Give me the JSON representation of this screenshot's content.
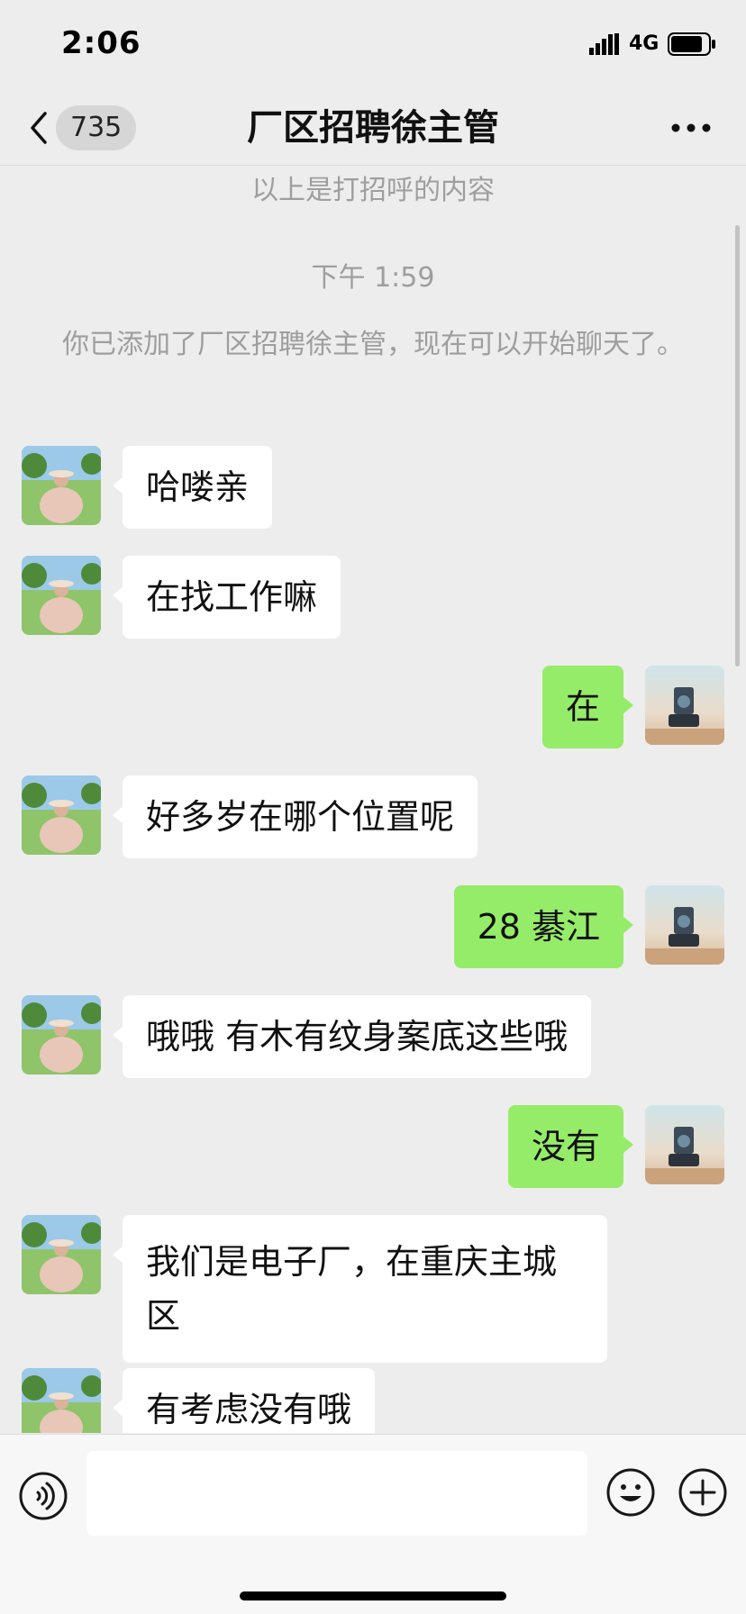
{
  "status_bar": {
    "time": "2:06",
    "network": "4G"
  },
  "nav": {
    "unread_count": "735",
    "title": "厂区招聘徐主管"
  },
  "system": {
    "greeting_note": "以上是打招呼的内容",
    "timestamp": "下午 1:59",
    "added_note": "你已添加了厂区招聘徐主管，现在可以开始聊天了。"
  },
  "messages": [
    {
      "side": "left",
      "text": "哈喽亲"
    },
    {
      "side": "left",
      "text": "在找工作嘛"
    },
    {
      "side": "right",
      "text": "在"
    },
    {
      "side": "left",
      "text": "好多岁在哪个位置呢"
    },
    {
      "side": "right",
      "text": "28 綦江"
    },
    {
      "side": "left",
      "text": "哦哦 有木有纹身案底这些哦"
    },
    {
      "side": "right",
      "text": "没有"
    },
    {
      "side": "left",
      "text": "我们是电子厂，在重庆主城区"
    },
    {
      "side": "left",
      "text": "有考虑没有哦"
    }
  ],
  "input": {
    "value": "",
    "placeholder": ""
  },
  "colors": {
    "background": "#ededed",
    "outgoing_bubble": "#95ec69",
    "incoming_bubble": "#ffffff",
    "system_text": "#9e9e9e"
  },
  "icons": [
    "back-icon",
    "more-icon",
    "voice-icon",
    "emoji-icon",
    "plus-icon",
    "signal-icon",
    "battery-icon"
  ]
}
